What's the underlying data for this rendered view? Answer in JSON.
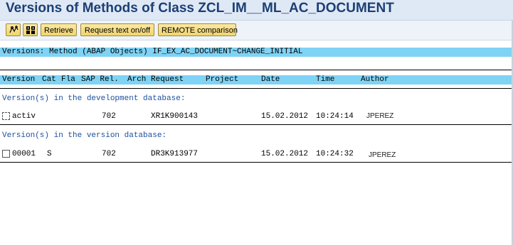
{
  "window": {
    "title": "Versions of Methods of Class ZCL_IM__ML_AC_DOCUMENT"
  },
  "toolbar": {
    "icons": [
      {
        "name": "compare-icon"
      },
      {
        "name": "select-all-icon"
      }
    ],
    "buttons": [
      {
        "label": "Retrieve"
      },
      {
        "label": "Request text on/off"
      },
      {
        "label": "REMOTE comparison"
      }
    ]
  },
  "object_line": "Versions: Method (ABAP Objects) IF_EX_AC_DOCUMENT~CHANGE_INITIAL",
  "table": {
    "headers": [
      "Version",
      "Cat",
      "Fla",
      "SAP Rel.",
      "Arch",
      "Request",
      "Project",
      "Date",
      "Time",
      "Author"
    ],
    "sections": [
      {
        "title": "Version(s) in the development database:",
        "rows": [
          {
            "version": "activ",
            "cat": "",
            "sap_rel": "702",
            "request": "XR1K900143",
            "date": "15.02.2012",
            "time": "10:24:14",
            "author": "JPEREZ",
            "checkbox": "dashed"
          }
        ]
      },
      {
        "title": "Version(s) in the version database:",
        "rows": [
          {
            "version": "00001",
            "cat": "S",
            "sap_rel": "702",
            "request": "DR3K913977",
            "date": "15.02.2012",
            "time": "10:24:32",
            "author": "JPEREZ",
            "checkbox": "solid"
          }
        ]
      }
    ]
  },
  "colors": {
    "title_text": "#1d3f75",
    "highlight_bar": "#7fd3f5",
    "section_text": "#1d4f9c"
  }
}
